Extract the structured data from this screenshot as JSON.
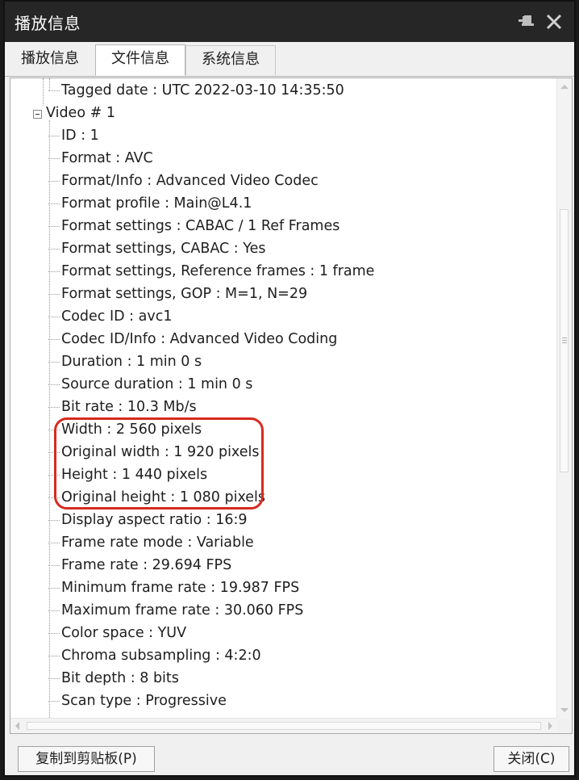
{
  "window": {
    "title": "播放信息",
    "pin_icon": "pin-icon",
    "close_icon": "close-icon"
  },
  "tabs": [
    {
      "label": "播放信息",
      "selected": false
    },
    {
      "label": "文件信息",
      "selected": true
    },
    {
      "label": "系统信息",
      "selected": false
    }
  ],
  "tree": {
    "prev_leaf": "Tagged date : UTC 2022-03-10 14:35:50",
    "section": "Video # 1",
    "items": [
      "ID : 1",
      "Format : AVC",
      "Format/Info : Advanced Video Codec",
      "Format profile : Main@L4.1",
      "Format settings : CABAC / 1 Ref Frames",
      "Format settings, CABAC : Yes",
      "Format settings, Reference frames : 1 frame",
      "Format settings, GOP : M=1, N=29",
      "Codec ID : avc1",
      "Codec ID/Info : Advanced Video Coding",
      "Duration : 1 min 0 s",
      "Source duration : 1 min 0 s",
      "Bit rate : 10.3 Mb/s",
      "Width : 2 560 pixels",
      "Original width : 1 920 pixels",
      "Height : 1 440 pixels",
      "Original height : 1 080 pixels",
      "Display aspect ratio : 16:9",
      "Frame rate mode : Variable",
      "Frame rate : 29.694 FPS",
      "Minimum frame rate : 19.987 FPS",
      "Maximum frame rate : 30.060 FPS",
      "Color space : YUV",
      "Chroma subsampling : 4:2:0",
      "Bit depth : 8 bits",
      "Scan type : Progressive"
    ]
  },
  "buttons": {
    "copy": "复制到剪贴板(P)",
    "close": "关闭(C)"
  },
  "colors": {
    "highlight": "#d62b1f",
    "titlebar": "#262626"
  }
}
